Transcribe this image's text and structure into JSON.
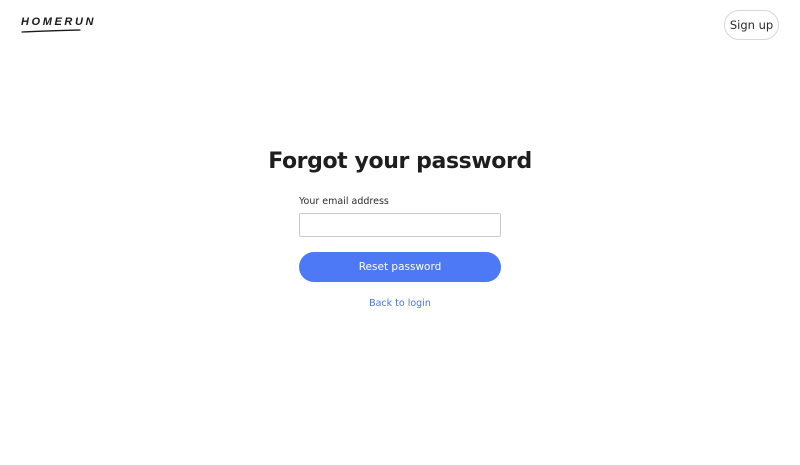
{
  "header": {
    "logo_text": "HOMERUN",
    "signup_label": "Sign up"
  },
  "main": {
    "title": "Forgot your password",
    "email_label": "Your email address",
    "email_value": "",
    "email_placeholder": "",
    "reset_label": "Reset password",
    "back_label": "Back to login"
  },
  "colors": {
    "accent": "#4d79f6",
    "link": "#4a74ee",
    "text": "#1e1e1e"
  }
}
